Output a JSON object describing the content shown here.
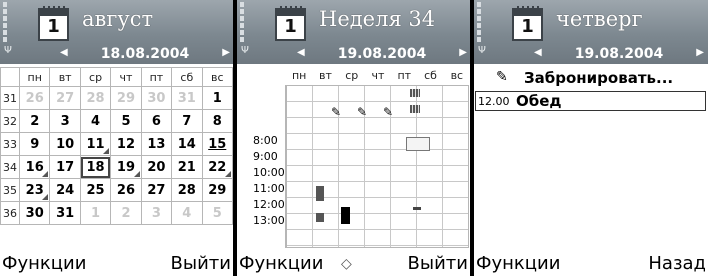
{
  "screens": [
    {
      "icon_day": "1",
      "title": "август",
      "date": "18.08.2004",
      "weekday_headers": [
        "пн",
        "вт",
        "ср",
        "чт",
        "пт",
        "сб",
        "вс"
      ],
      "weeks": [
        {
          "wk": "31",
          "days": [
            {
              "d": "26",
              "dim": true
            },
            {
              "d": "27",
              "dim": true
            },
            {
              "d": "28",
              "dim": true
            },
            {
              "d": "29",
              "dim": true
            },
            {
              "d": "30",
              "dim": true
            },
            {
              "d": "31",
              "dim": true
            },
            {
              "d": "1"
            }
          ]
        },
        {
          "wk": "32",
          "days": [
            {
              "d": "2"
            },
            {
              "d": "3"
            },
            {
              "d": "4"
            },
            {
              "d": "5"
            },
            {
              "d": "6"
            },
            {
              "d": "7"
            },
            {
              "d": "8"
            }
          ]
        },
        {
          "wk": "33",
          "days": [
            {
              "d": "9"
            },
            {
              "d": "10"
            },
            {
              "d": "11",
              "mark": true
            },
            {
              "d": "12"
            },
            {
              "d": "13"
            },
            {
              "d": "14"
            },
            {
              "d": "15",
              "underline": true
            }
          ]
        },
        {
          "wk": "34",
          "days": [
            {
              "d": "16",
              "mark": true
            },
            {
              "d": "17"
            },
            {
              "d": "18",
              "selected": true
            },
            {
              "d": "19",
              "mark": true
            },
            {
              "d": "20"
            },
            {
              "d": "21"
            },
            {
              "d": "22",
              "mark": true
            }
          ]
        },
        {
          "wk": "35",
          "days": [
            {
              "d": "23",
              "mark": true
            },
            {
              "d": "24"
            },
            {
              "d": "25"
            },
            {
              "d": "26"
            },
            {
              "d": "27"
            },
            {
              "d": "28"
            },
            {
              "d": "29"
            }
          ]
        },
        {
          "wk": "36",
          "days": [
            {
              "d": "30"
            },
            {
              "d": "31"
            },
            {
              "d": "1",
              "dim": true
            },
            {
              "d": "2",
              "dim": true
            },
            {
              "d": "3",
              "dim": true
            },
            {
              "d": "4",
              "dim": true
            },
            {
              "d": "5",
              "dim": true
            }
          ]
        }
      ],
      "softkey_left": "Функции",
      "softkey_right": "Выйти"
    },
    {
      "icon_day": "1",
      "title": "Неделя 34",
      "date": "19.08.2004",
      "weekday_headers": [
        "пн",
        "вт",
        "ср",
        "чт",
        "пт",
        "сб",
        "вс"
      ],
      "hours": [
        "8:00",
        "9:00",
        "10:00",
        "11:00",
        "12:00",
        "13:00"
      ],
      "softkey_left": "Функции",
      "softkey_middle": "◇",
      "softkey_right": "Выйти"
    },
    {
      "icon_day": "1",
      "title": "четверг",
      "date": "19.08.2004",
      "entries": [
        {
          "icon": "memo-icon",
          "time": "",
          "text": "Забронировать..."
        },
        {
          "icon": "",
          "time": "12.00",
          "text": "Обед"
        }
      ],
      "softkey_left": "Функции",
      "softkey_right": "Назад"
    }
  ],
  "colors": {
    "header_top": "#9da6ad",
    "header_bottom": "#6e7880",
    "grid_line": "#b6b6b6",
    "dim_text": "#c8c8c8"
  }
}
